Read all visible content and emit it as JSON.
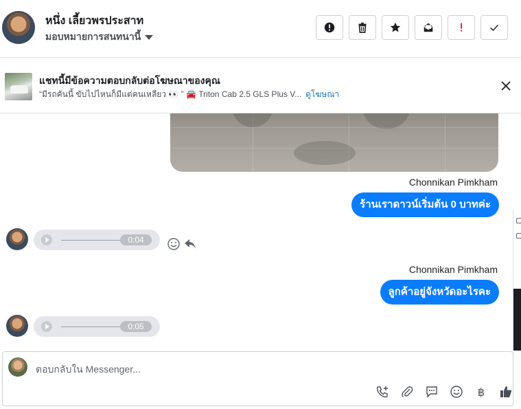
{
  "header": {
    "contact_name": "หนึ่ง เลี้ยวพรประสาท",
    "assign_label": "มอบหมายการสนทนานี้",
    "actions": [
      {
        "name": "alert-circle-icon",
        "label": "!"
      },
      {
        "name": "trash-icon"
      },
      {
        "name": "star-icon"
      },
      {
        "name": "mail-open-icon"
      },
      {
        "name": "exclamation-icon",
        "label": "!"
      },
      {
        "name": "check-icon"
      }
    ]
  },
  "ad_banner": {
    "title": "แชทนี้มีข้อความตอบกลับต่อโฆษณาของคุณ",
    "quote": "“มีรถคันนี้ ขับไปไหนก็มีแต่คนเหลียว 👀 ” 🚘 Triton Cab 2.5 GLS Plus V...",
    "link": "ดูโฆษณา"
  },
  "messages": [
    {
      "sender": "Chonnikan Pimkham",
      "text": "ร้านเราดาวน์เริ่มต้น 0 บาทค่ะ"
    },
    {
      "audio_time": "0:04"
    },
    {
      "sender": "Chonnikan Pimkham",
      "text": "ลูกค้าอยู่จังหวัดอะไรคะ"
    },
    {
      "audio_time": "0:05"
    }
  ],
  "composer": {
    "placeholder": "ตอบกลับใน Messenger...",
    "baht_symbol": "฿"
  },
  "colors": {
    "accent": "#0a7cff",
    "link": "#1a73b8",
    "alert_red": "#e41e3f"
  }
}
